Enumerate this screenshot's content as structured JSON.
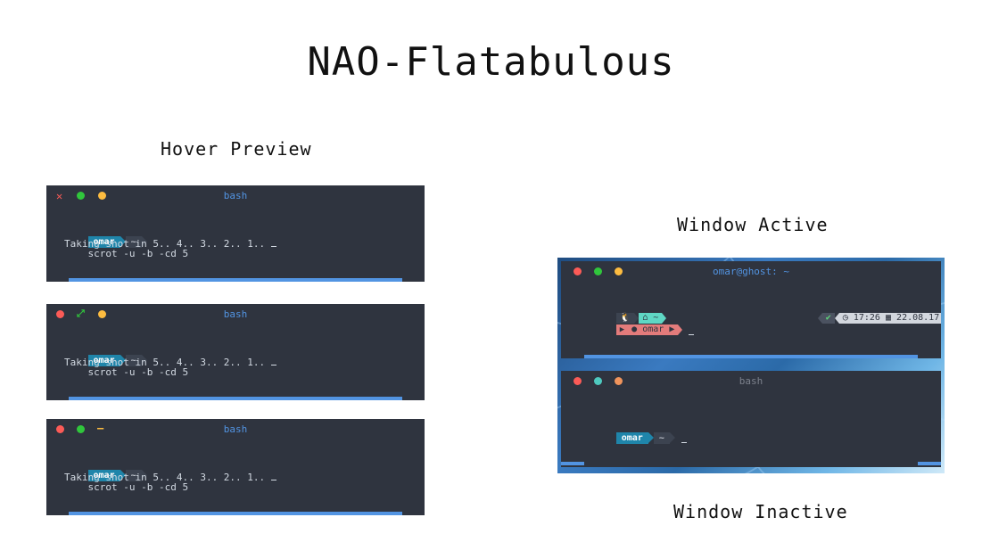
{
  "title": "NAO-Flatabulous",
  "headings": {
    "hover_preview": "Hover Preview",
    "window_active": "Window Active",
    "window_inactive": "Window Inactive"
  },
  "colors": {
    "terminal_bg": "#2f343f",
    "accent_blue": "#5294e2",
    "close_red": "#fc5b57",
    "max_green": "#30c63c",
    "min_yellow": "#fdbc40"
  },
  "hover_terminals": [
    {
      "title": "bash",
      "user": "omar",
      "dir": "~",
      "command": "scrot -u -b -cd 5",
      "output": "Taking shot in 5.. 4.. 3.. 2.. 1.. ",
      "hovered_button": "close",
      "hover_icon": "close-x-icon"
    },
    {
      "title": "bash",
      "user": "omar",
      "dir": "~",
      "command": "scrot -u -b -cd 5",
      "output": "Taking shot in 5.. 4.. 3.. 2.. 1.. ",
      "hovered_button": "maximize",
      "hover_icon": "maximize-arrows-icon"
    },
    {
      "title": "bash",
      "user": "omar",
      "dir": "~",
      "command": "scrot -u -b -cd 5",
      "output": "Taking shot in 5.. 4.. 3.. 2.. 1.. ",
      "hovered_button": "minimize",
      "hover_icon": "minimize-dash-icon"
    }
  ],
  "active_window": {
    "title": "omar@ghost: ~",
    "linux_icon": "tux-icon",
    "home_icon": "home-icon",
    "dir": "~",
    "user": "omar",
    "check_icon": "check-icon",
    "clock_icon": "clock-icon",
    "time": "17:26",
    "calendar_icon": "calendar-icon",
    "date": "22.08.17"
  },
  "inactive_window": {
    "title": "bash",
    "user": "omar",
    "dir": "~"
  }
}
